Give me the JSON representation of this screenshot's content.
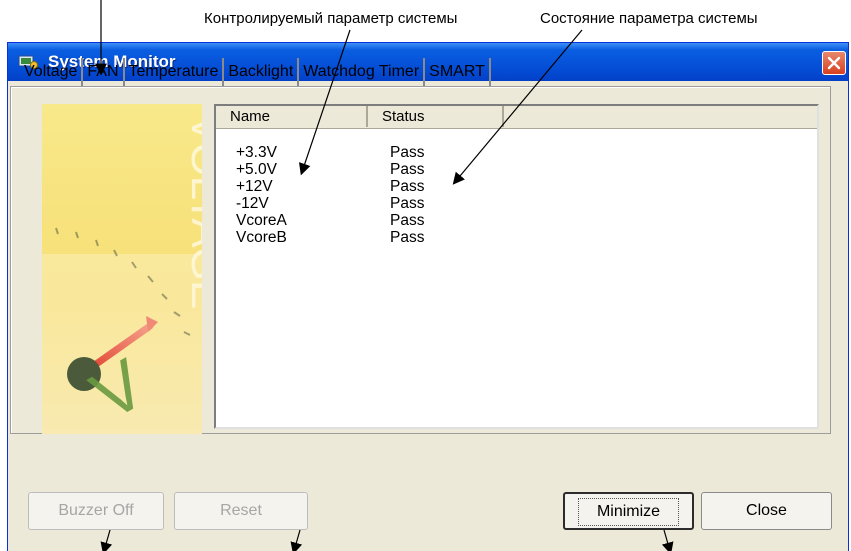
{
  "annotations": {
    "controlled_parameter": "Контролируемый параметр системы",
    "parameter_state": "Состояние параметра системы"
  },
  "window": {
    "title": "System Monitor"
  },
  "tabs": [
    "Voltage",
    "FAN",
    "Temperature",
    "Backlight",
    "Watchdog Timer",
    "SMART"
  ],
  "active_tab": "Voltage",
  "illustration": {
    "text": "VOLTAGE",
    "symbol": "V",
    "background": "#f6e17a",
    "needle_color": "#e8503a"
  },
  "list": {
    "columns": [
      "Name",
      "Status",
      ""
    ],
    "rows": [
      {
        "name": "+3.3V",
        "status": "Pass"
      },
      {
        "name": "+5.0V",
        "status": "Pass"
      },
      {
        "name": "+12V",
        "status": "Pass"
      },
      {
        "name": "-12V",
        "status": "Pass"
      },
      {
        "name": "VcoreA",
        "status": "Pass"
      },
      {
        "name": "VcoreB",
        "status": "Pass"
      }
    ]
  },
  "buttons": {
    "buzzer_off": "Buzzer Off",
    "reset": "Reset",
    "minimize": "Minimize",
    "close": "Close"
  },
  "colors": {
    "title_bar": "#0550d8",
    "window_bg": "#ece9d8",
    "close_button": "#d8401f"
  }
}
